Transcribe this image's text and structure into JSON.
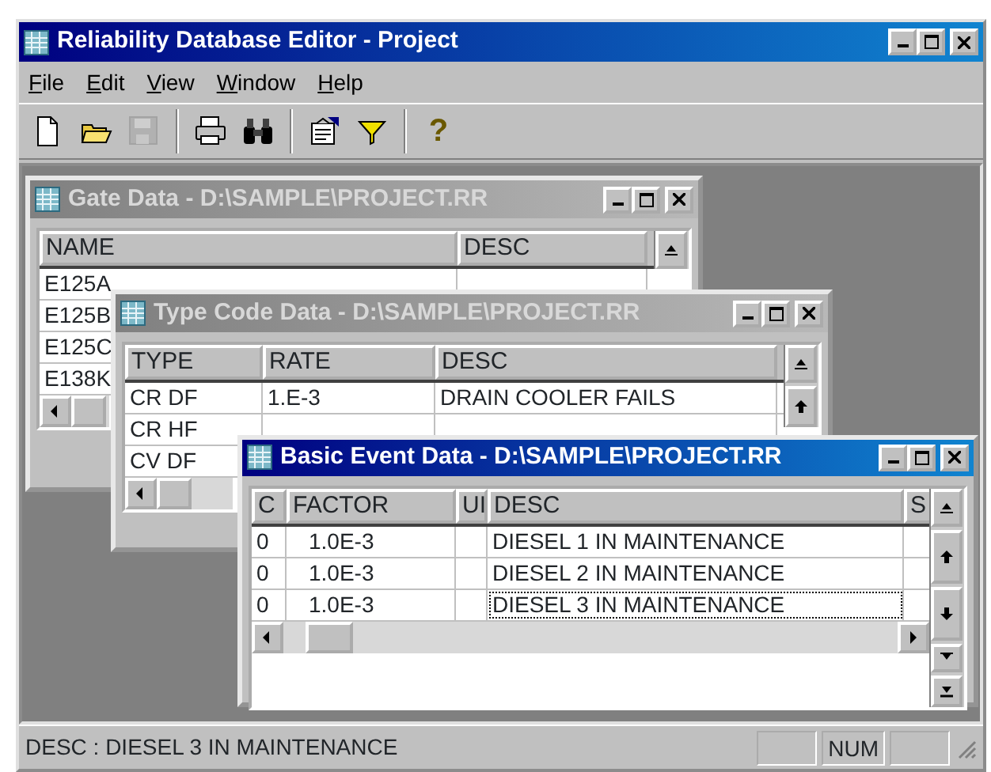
{
  "window": {
    "title": "Reliability Database Editor - Project"
  },
  "menu": [
    {
      "label": "File"
    },
    {
      "label": "Edit"
    },
    {
      "label": "View"
    },
    {
      "label": "Window"
    },
    {
      "label": "Help"
    }
  ],
  "toolbar": [
    {
      "kind": "new",
      "disabled": false
    },
    {
      "kind": "open",
      "disabled": false
    },
    {
      "kind": "save",
      "disabled": true
    },
    {
      "kind": "separator"
    },
    {
      "kind": "print",
      "disabled": false
    },
    {
      "kind": "find",
      "disabled": false
    },
    {
      "kind": "separator"
    },
    {
      "kind": "properties",
      "disabled": false
    },
    {
      "kind": "filter",
      "disabled": false
    },
    {
      "kind": "separator"
    },
    {
      "kind": "help",
      "glyph": "?",
      "disabled": false
    }
  ],
  "child_windows": [
    {
      "title": "Gate Data - D:\\SAMPLE\\PROJECT.RR",
      "active": false,
      "columns": [
        "NAME",
        "DESC"
      ],
      "rows": [
        {
          "cells": [
            "E125A"
          ],
          "focused": false
        },
        {
          "cells": [
            "E125B"
          ],
          "focused": false
        },
        {
          "cells": [
            "E125C"
          ],
          "focused": false
        },
        {
          "cells": [
            "E138K"
          ],
          "focused": false
        }
      ]
    },
    {
      "title": "Type Code Data - D:\\SAMPLE\\PROJECT.RR",
      "active": false,
      "columns": [
        "TYPE",
        "RATE",
        "DESC"
      ],
      "rows": [
        {
          "cells": [
            "CR DF",
            "1.E-3",
            "DRAIN COOLER FAILS"
          ],
          "focused": false
        },
        {
          "cells": [
            "CR HF"
          ],
          "focused": false
        },
        {
          "cells": [
            "CV DF"
          ],
          "focused": false
        }
      ]
    },
    {
      "title": "Basic Event Data - D:\\SAMPLE\\PROJECT.RR",
      "active": true,
      "columns": [
        "C",
        "FACTOR",
        "UI",
        "DESC",
        "S"
      ],
      "rows": [
        {
          "cells": [
            "0",
            "1.0E-3",
            null,
            "DIESEL 1 IN MAINTENANCE"
          ],
          "focused": false
        },
        {
          "cells": [
            "0",
            "1.0E-3",
            null,
            "DIESEL 2 IN MAINTENANCE"
          ],
          "focused": false
        },
        {
          "cells": [
            "0",
            "1.0E-3",
            null,
            "DIESEL 3 IN MAINTENANCE"
          ],
          "focused": true
        }
      ]
    }
  ],
  "status_bar": {
    "text": "DESC :  DIESEL 3 IN MAINTENANCE",
    "indicators": [
      {
        "kind": "blank"
      },
      {
        "kind": "text",
        "label": "NUM"
      },
      {
        "kind": "blank"
      }
    ]
  }
}
